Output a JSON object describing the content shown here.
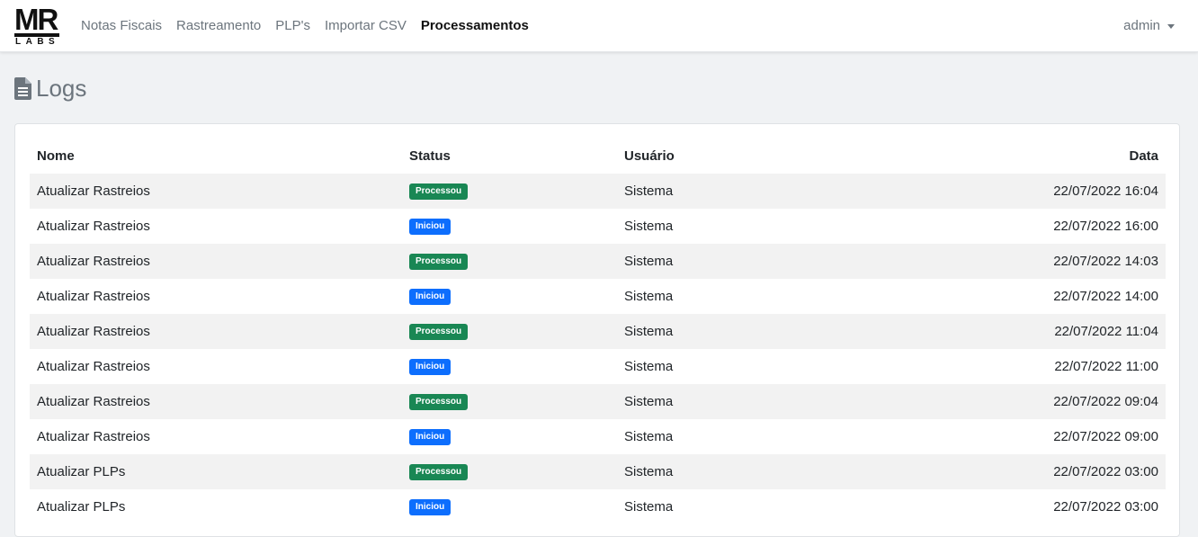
{
  "brand": {
    "mr": "MR",
    "labs": "LABS"
  },
  "nav": {
    "links": [
      "Notas Fiscais",
      "Rastreamento",
      "PLP's",
      "Importar CSV",
      "Processamentos"
    ],
    "active": "Processamentos",
    "user": "admin"
  },
  "page": {
    "title": "Logs",
    "icon": "file-lines-icon"
  },
  "table": {
    "headers": [
      "Nome",
      "Status",
      "Usuário",
      "Data"
    ],
    "rows": [
      {
        "nome": "Atualizar Rastreios",
        "status": "Processou",
        "usuario": "Sistema",
        "data": "22/07/2022 16:04"
      },
      {
        "nome": "Atualizar Rastreios",
        "status": "Iniciou",
        "usuario": "Sistema",
        "data": "22/07/2022 16:00"
      },
      {
        "nome": "Atualizar Rastreios",
        "status": "Processou",
        "usuario": "Sistema",
        "data": "22/07/2022 14:03"
      },
      {
        "nome": "Atualizar Rastreios",
        "status": "Iniciou",
        "usuario": "Sistema",
        "data": "22/07/2022 14:00"
      },
      {
        "nome": "Atualizar Rastreios",
        "status": "Processou",
        "usuario": "Sistema",
        "data": "22/07/2022 11:04"
      },
      {
        "nome": "Atualizar Rastreios",
        "status": "Iniciou",
        "usuario": "Sistema",
        "data": "22/07/2022 11:00"
      },
      {
        "nome": "Atualizar Rastreios",
        "status": "Processou",
        "usuario": "Sistema",
        "data": "22/07/2022 09:04"
      },
      {
        "nome": "Atualizar Rastreios",
        "status": "Iniciou",
        "usuario": "Sistema",
        "data": "22/07/2022 09:00"
      },
      {
        "nome": "Atualizar PLPs",
        "status": "Processou",
        "usuario": "Sistema",
        "data": "22/07/2022 03:00"
      },
      {
        "nome": "Atualizar PLPs",
        "status": "Iniciou",
        "usuario": "Sistema",
        "data": "22/07/2022 03:00"
      }
    ]
  },
  "colors": {
    "processou": "#198754",
    "iniciou": "#0d6efd"
  }
}
